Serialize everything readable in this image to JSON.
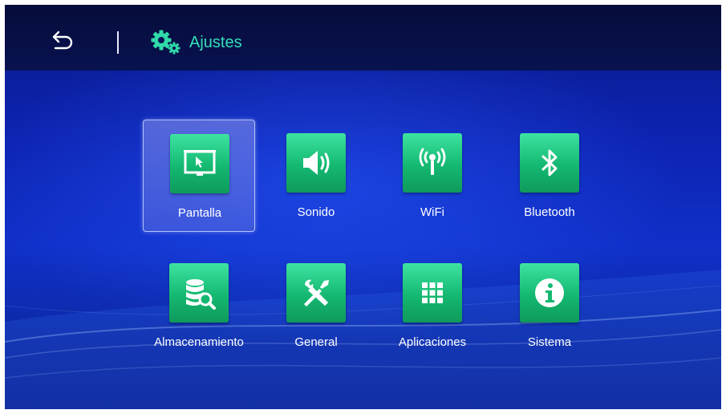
{
  "header": {
    "title": "Ajustes",
    "back_icon": "back-arrow-icon",
    "settings_icon": "gears-icon"
  },
  "menu": {
    "items": [
      {
        "label": "Pantalla",
        "icon": "screen-display-icon",
        "selected": true
      },
      {
        "label": "Sonido",
        "icon": "speaker-icon",
        "selected": false
      },
      {
        "label": "WiFi",
        "icon": "wifi-antenna-icon",
        "selected": false
      },
      {
        "label": "Bluetooth",
        "icon": "bluetooth-icon",
        "selected": false
      },
      {
        "label": "Almacenamiento",
        "icon": "storage-search-icon",
        "selected": false
      },
      {
        "label": "General",
        "icon": "tools-icon",
        "selected": false
      },
      {
        "label": "Aplicaciones",
        "icon": "apps-grid-icon",
        "selected": false
      },
      {
        "label": "Sistema",
        "icon": "info-icon",
        "selected": false
      }
    ]
  },
  "colors": {
    "accent": "#33dfb8",
    "tile_green": "#14b871",
    "background": "#0d24b4",
    "header": "#060c3a"
  }
}
